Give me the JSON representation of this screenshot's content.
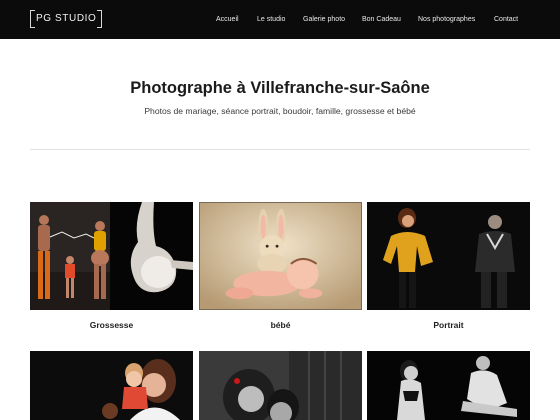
{
  "header": {
    "logo": "PG STUDIO",
    "nav": [
      "Accueil",
      "Le studio",
      "Galerie photo",
      "Bon Cadeau",
      "Nos photographes",
      "Contact"
    ]
  },
  "hero": {
    "title": "Photographe à Villefranche-sur-Saône",
    "subtitle": "Photos de mariage, séance portrait, boudoir, famille, grossesse et bébé"
  },
  "gallery": {
    "categories": [
      "Grossesse",
      "bébé",
      "Portrait"
    ]
  },
  "colors": {
    "header_bg": "#0b0b0b",
    "accent_yellow": "#d99a19",
    "baby_bg": "#d9c3a0"
  }
}
